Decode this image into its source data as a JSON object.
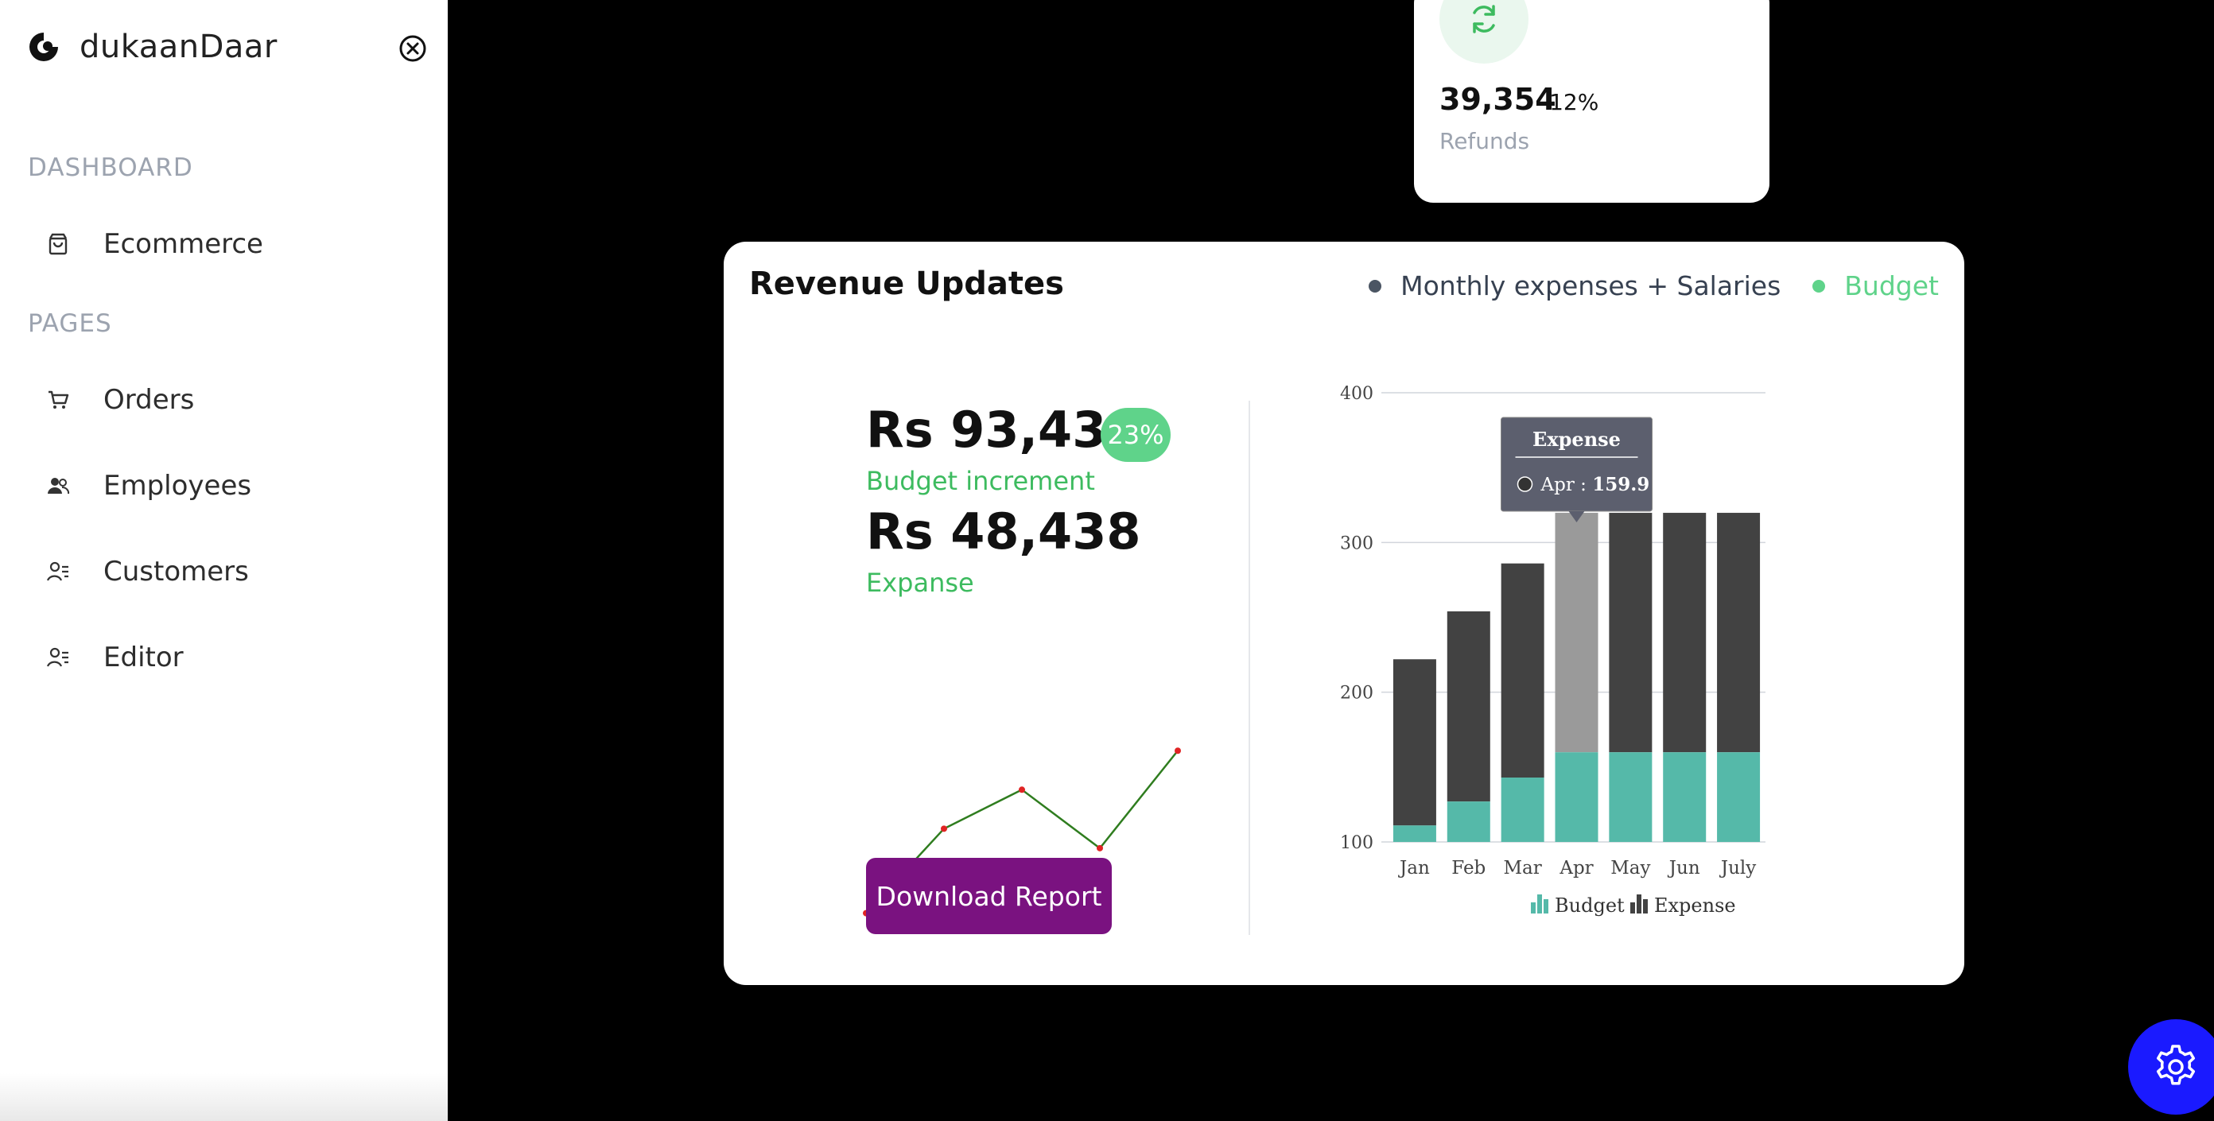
{
  "brand": {
    "name": "dukaanDaar"
  },
  "sidebar": {
    "sections": [
      {
        "title": "DASHBOARD",
        "items": [
          {
            "label": "Ecommerce",
            "icon": "shopping-bag-icon"
          }
        ]
      },
      {
        "title": "PAGES",
        "items": [
          {
            "label": "Orders",
            "icon": "cart-icon"
          },
          {
            "label": "Employees",
            "icon": "users-icon"
          },
          {
            "label": "Customers",
            "icon": "user-list-icon"
          },
          {
            "label": "Editor",
            "icon": "user-list-icon"
          }
        ]
      }
    ]
  },
  "refund_card": {
    "value": "39,354",
    "change": "-12%",
    "label": "Refunds",
    "icon": "refresh-icon",
    "accent": "#3dbb5f"
  },
  "revenue": {
    "title": "Revenue Updates",
    "legend": [
      {
        "label": "Monthly expenses + Salaries",
        "color": "#4b5563"
      },
      {
        "label": "Budget",
        "color": "#5fd38a"
      }
    ],
    "budget_value": "Rs 93,438",
    "budget_percent": "23%",
    "budget_label": "Budget increment",
    "expense_value": "Rs 48,438",
    "expense_label": "Expanse",
    "download_label": "Download Report",
    "download_color": "#7a1280"
  },
  "chart_data": [
    {
      "type": "line",
      "x": [
        1,
        2,
        3,
        4,
        5
      ],
      "series": [
        {
          "values": [
            14,
            27,
            33,
            24,
            39
          ],
          "color": "#2f7d1f",
          "marker_color": "#e02424"
        }
      ]
    },
    {
      "type": "bar",
      "stacked": true,
      "categories": [
        "Jan",
        "Feb",
        "Mar",
        "Apr",
        "May",
        "Jun",
        "July"
      ],
      "series": [
        {
          "name": "Budget",
          "values": [
            111,
            127,
            143,
            159.9,
            159.9,
            159.9,
            159.9
          ],
          "color": "#55b9a9"
        },
        {
          "name": "Expense",
          "values": [
            111,
            127,
            143,
            159.9,
            159.9,
            159.9,
            159.9
          ],
          "color": "#424242"
        }
      ],
      "ylim": [
        100,
        400
      ],
      "yticks": [
        100,
        200,
        300,
        400
      ],
      "grid": true,
      "legend_position": "bottom",
      "highlighted_category": "Apr",
      "tooltip": {
        "title": "Expense",
        "label": "Apr",
        "value": "159.9"
      }
    }
  ],
  "settings": {
    "icon": "gear-icon",
    "color": "#1a1aff"
  }
}
